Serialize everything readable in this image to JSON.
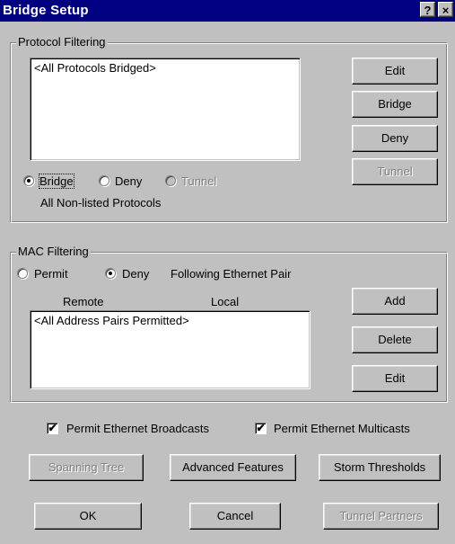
{
  "window": {
    "title": "Bridge Setup",
    "help_glyph": "?",
    "close_glyph": "×"
  },
  "protocol_filtering": {
    "legend": "Protocol Filtering",
    "list_items": [
      "<All Protocols Bridged>"
    ],
    "buttons": {
      "edit": "Edit",
      "bridge": "Bridge",
      "deny": "Deny",
      "tunnel": "Tunnel"
    },
    "radios": {
      "bridge": "Bridge",
      "deny": "Deny",
      "tunnel": "Tunnel",
      "selected": "bridge"
    },
    "non_listed_label": "All Non-listed Protocols"
  },
  "mac_filtering": {
    "legend": "MAC Filtering",
    "radios": {
      "permit": "Permit",
      "deny": "Deny",
      "selected": "deny"
    },
    "following_label": "Following Ethernet Pair",
    "columns": {
      "remote": "Remote",
      "local": "Local"
    },
    "list_items": [
      "<All Address Pairs Permitted>"
    ],
    "buttons": {
      "add": "Add",
      "delete": "Delete",
      "edit": "Edit"
    }
  },
  "options": {
    "broadcasts": {
      "label": "Permit Ethernet Broadcasts",
      "checked": true
    },
    "multicasts": {
      "label": "Permit Ethernet Multicasts",
      "checked": true
    }
  },
  "action_buttons": {
    "spanning_tree": "Spanning Tree",
    "advanced_features": "Advanced Features",
    "storm_thresholds": "Storm Thresholds",
    "ok": "OK",
    "cancel": "Cancel",
    "tunnel_partners": "Tunnel Partners"
  },
  "check_glyph": "✔",
  "colors": {
    "titlebar": "#000080",
    "face": "#c0c0c0",
    "disabled_text": "#808080"
  }
}
